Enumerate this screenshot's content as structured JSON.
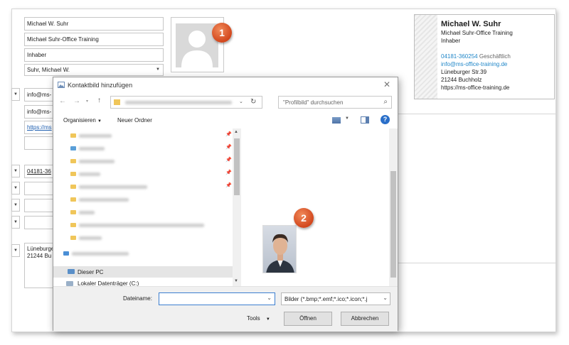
{
  "contact_form": {
    "name": "Michael W. Suhr",
    "company": "Michael Suhr-Office Training",
    "job_title": "Inhaber",
    "file_as": "Suhr, Michael W.",
    "email1": "info@ms-",
    "email2": "info@ms-",
    "web": "https://ms",
    "phone": "04181-36",
    "address": [
      "Lüneburge",
      "21244 Bu"
    ]
  },
  "business_card": {
    "name": "Michael W. Suhr",
    "company": "Michael Suhr-Office Training",
    "title": "Inhaber",
    "phone": "04181-360254",
    "phone_type": "Geschäftlich",
    "email": "info@ms-office-training.de",
    "street": "Lüneburger Str.39",
    "city": "21244 Buchholz",
    "website": "https://ms-office-training.de"
  },
  "badges": {
    "one": "1",
    "two": "2"
  },
  "dialog": {
    "title": "Kontaktbild hinzufügen",
    "search_placeholder": "\"Profilbild\" durchsuchen",
    "toolbar": {
      "organize": "Organisieren",
      "new_folder": "Neuer Ordner"
    },
    "tree": {
      "this_pc": "Dieser PC",
      "local_disk": "Lokaler Datenträger (C:)"
    },
    "filename_label": "Dateiname:",
    "filename_value": "",
    "filter": "Bilder (*.bmp;*.emf;*.ico;*.icon;*.j",
    "tools": "Tools",
    "open": "Öffnen",
    "cancel": "Abbrechen"
  },
  "colors": {
    "badge": "#d9532a",
    "link": "#1f86c8",
    "selection": "#e5e5e5"
  }
}
